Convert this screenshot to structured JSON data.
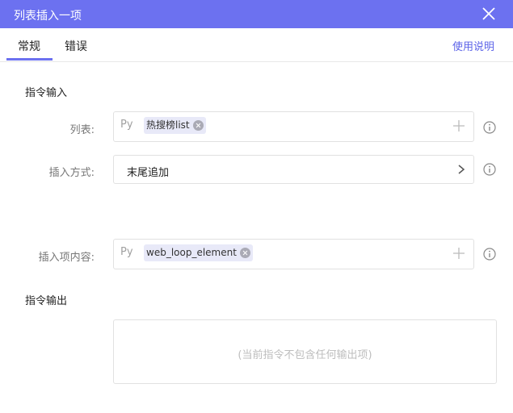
{
  "window": {
    "title": "列表插入一项"
  },
  "tabs": {
    "general": "常规",
    "error": "错误"
  },
  "help_link": "使用说明",
  "input_section": {
    "title": "指令输入"
  },
  "fields": {
    "list": {
      "label": "列表:",
      "prefix": "Py",
      "chip": "热搜榜list"
    },
    "insert_mode": {
      "label": "插入方式:",
      "value": "末尾追加"
    },
    "insert_content": {
      "label": "插入项内容:",
      "prefix": "Py",
      "chip": "web_loop_element"
    }
  },
  "output_section": {
    "title": "指令输出",
    "empty_text": "(当前指令不包含任何输出项)"
  },
  "colors": {
    "accent": "#6c71f0",
    "link": "#5c63e8"
  },
  "icons": [
    "close-icon",
    "plus-icon",
    "info-icon",
    "chevron-right-icon",
    "chip-remove-icon"
  ]
}
